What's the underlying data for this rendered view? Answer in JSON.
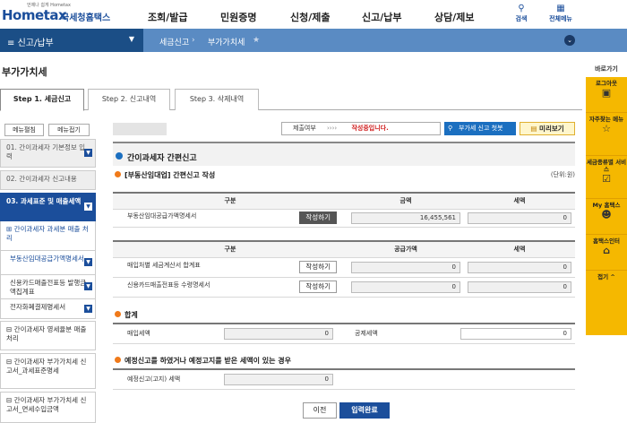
{
  "header": {
    "logo_sub": "언제나 쉽게 Hometax",
    "logo_main": "Hometax",
    "logo_kr": "국세청홈택스",
    "menu": [
      "조회/발급",
      "민원증명",
      "신청/제출",
      "신고/납부",
      "상담/제보"
    ],
    "search_label": "검색",
    "all_menu_label": "전체메뉴"
  },
  "lnb": {
    "current": "신고/납부",
    "crumbs": [
      "세금신고",
      "부가가치세"
    ]
  },
  "page_title": "부가가치세",
  "tabs": [
    "Step 1. 세금신고",
    "Step 2. 신고내역",
    "Step 3. 삭제내역"
  ],
  "left": {
    "expand_btn": "메뉴펼침",
    "collapse_btn": "메뉴접기",
    "items": [
      "01. 간이과세자 기본정보 입력",
      "02. 간이과세자 신고내용",
      "03. 과세표준 및 매출세액",
      "간이과세자 과세분 매출 처리",
      "부동산임대공급가액명세서",
      "신용카드매출전표등 발행금액집계표",
      "전자화폐결제명세서",
      "간이과세자 영세율분 매출 처리",
      "간이과세자 부가가치세 신고서_과세표준명세",
      "간이과세자 부가가치세 신고서_면세수입금액"
    ]
  },
  "status_bar": {
    "label": "제출여부",
    "arrows": "››››",
    "state": "작성중입니다.",
    "help_btn": "부가세 신고 첫봇",
    "preview_btn": "미리보기"
  },
  "section_title": "간이과세자 간편신고",
  "subsection1": "[부동산임대업] 간편신고 작성",
  "unit": "(단위:원)",
  "table1": {
    "headers": [
      "구분",
      "금액",
      "세액"
    ],
    "row_label": "부동산임대공급가액명세서",
    "btn": "작성하기",
    "amount": "16,455,561",
    "tax": "0"
  },
  "table2": {
    "headers": [
      "구분",
      "공급가액",
      "세액"
    ],
    "rows": [
      {
        "label": "매입처별 세금계산서 합계표",
        "btn": "작성하기",
        "amount": "0",
        "tax": "0"
      },
      {
        "label": "신용카드매출전표등 수령명세서",
        "btn": "작성하기",
        "amount": "0",
        "tax": "0"
      }
    ]
  },
  "total_title": "합계",
  "total": {
    "purchase_tax_label": "매입세액",
    "purchase_tax": "0",
    "deduct_tax_label": "공제세액",
    "deduct_tax": "0"
  },
  "notice_title": "예정신고를 하였거나 예정고지를 받은 세액이 있는 경우",
  "notice": {
    "label": "예정신고(고지) 세액",
    "value": "0"
  },
  "buttons": {
    "prev": "이전",
    "submit": "입력완료"
  },
  "quick": {
    "title": "바로가기",
    "items": [
      "로그아웃",
      "자주찾는 메뉴",
      "세금종류별 서비스",
      "My 홈택스",
      "홈택스인터",
      "접기"
    ]
  }
}
